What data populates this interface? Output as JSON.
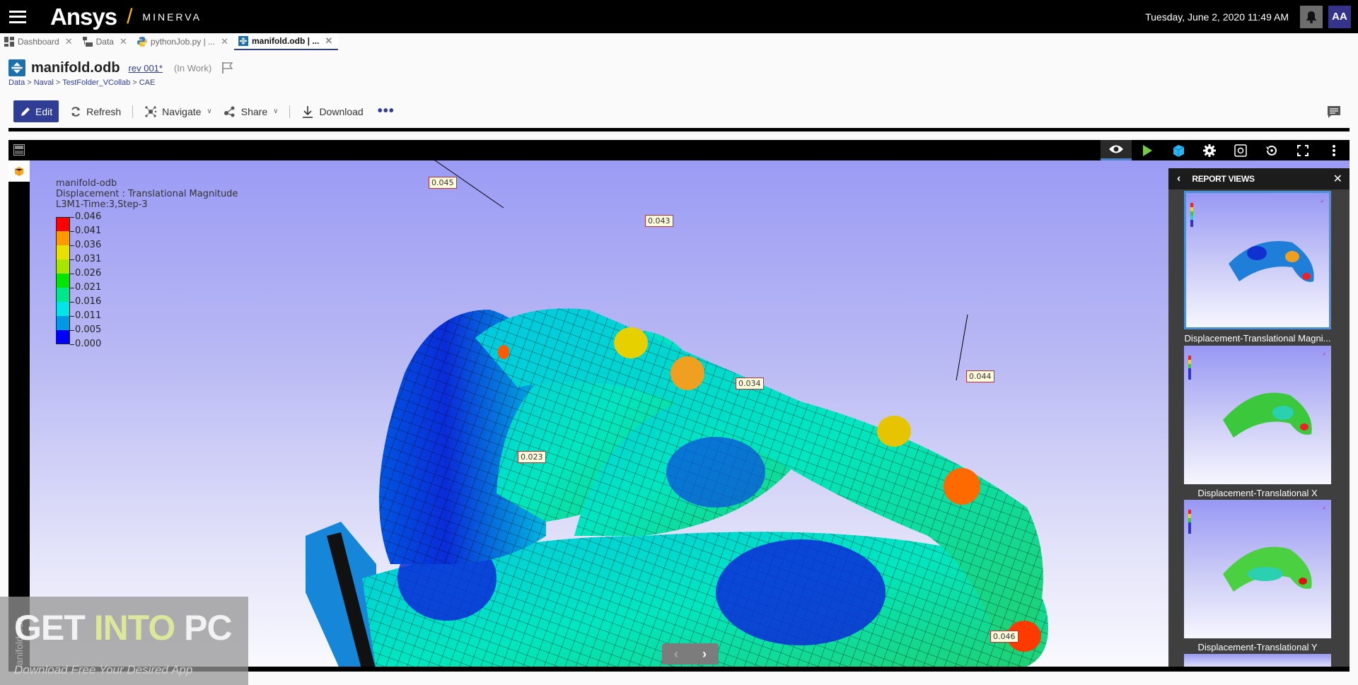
{
  "app": {
    "brand": "Ansys",
    "product": "MINERVA",
    "datetime": "Tuesday, June 2, 2020 11:49 AM",
    "user_initials": "AA",
    "accent": "#2f3d94",
    "brand_color": "#ffb71b"
  },
  "tabs": [
    {
      "label": "Dashboard",
      "icon": "dashboard-icon",
      "active": false
    },
    {
      "label": "Data",
      "icon": "folder-tree-icon",
      "active": false
    },
    {
      "label": "pythonJob.py | ...",
      "icon": "python-icon",
      "active": false
    },
    {
      "label": "manifold.odb | ...",
      "icon": "cae-file-icon",
      "active": true
    }
  ],
  "document": {
    "title": "manifold.odb",
    "revision": "rev 001*",
    "state": "(In Work)",
    "breadcrumb": [
      "Data",
      "Naval",
      "TestFolder_VCollab",
      "CAE"
    ]
  },
  "toolbar": {
    "edit": "Edit",
    "refresh": "Refresh",
    "navigate": "Navigate",
    "share": "Share",
    "download": "Download"
  },
  "viewer": {
    "side_label": "manifold.odb",
    "tools": [
      "eye-icon",
      "play-icon",
      "cube-icon",
      "gear-icon",
      "fit-view-icon",
      "reset-rotate-icon",
      "fullscreen-icon",
      "more-vertical-icon"
    ],
    "legend": {
      "model": "manifold-odb",
      "result": "Displacement : Translational Magnitude",
      "step": "L3M1-Time:3,Step-3",
      "ticks": [
        "0.046",
        "0.041",
        "0.036",
        "0.031",
        "0.026",
        "0.021",
        "0.016",
        "0.011",
        "0.005",
        "0.000"
      ],
      "colors": [
        "#ff0000",
        "#ff9900",
        "#e8e000",
        "#a6e600",
        "#00e600",
        "#00e68a",
        "#00e6e6",
        "#0099e6",
        "#0000ff"
      ]
    },
    "probes": [
      "0.045",
      "0.043",
      "0.034",
      "0.044",
      "0.023",
      "0.046"
    ]
  },
  "report_views": {
    "title": "REPORT VIEWS",
    "items": [
      {
        "caption": "Displacement-Translational Magni...",
        "selected": true
      },
      {
        "caption": "Displacement-Translational X",
        "selected": false
      },
      {
        "caption": "Displacement-Translational Y",
        "selected": false
      }
    ]
  },
  "watermark": {
    "main_1": "GET ",
    "main_2": "INTO",
    "main_3": " PC",
    "sub": "Download Free Your Desired App"
  }
}
